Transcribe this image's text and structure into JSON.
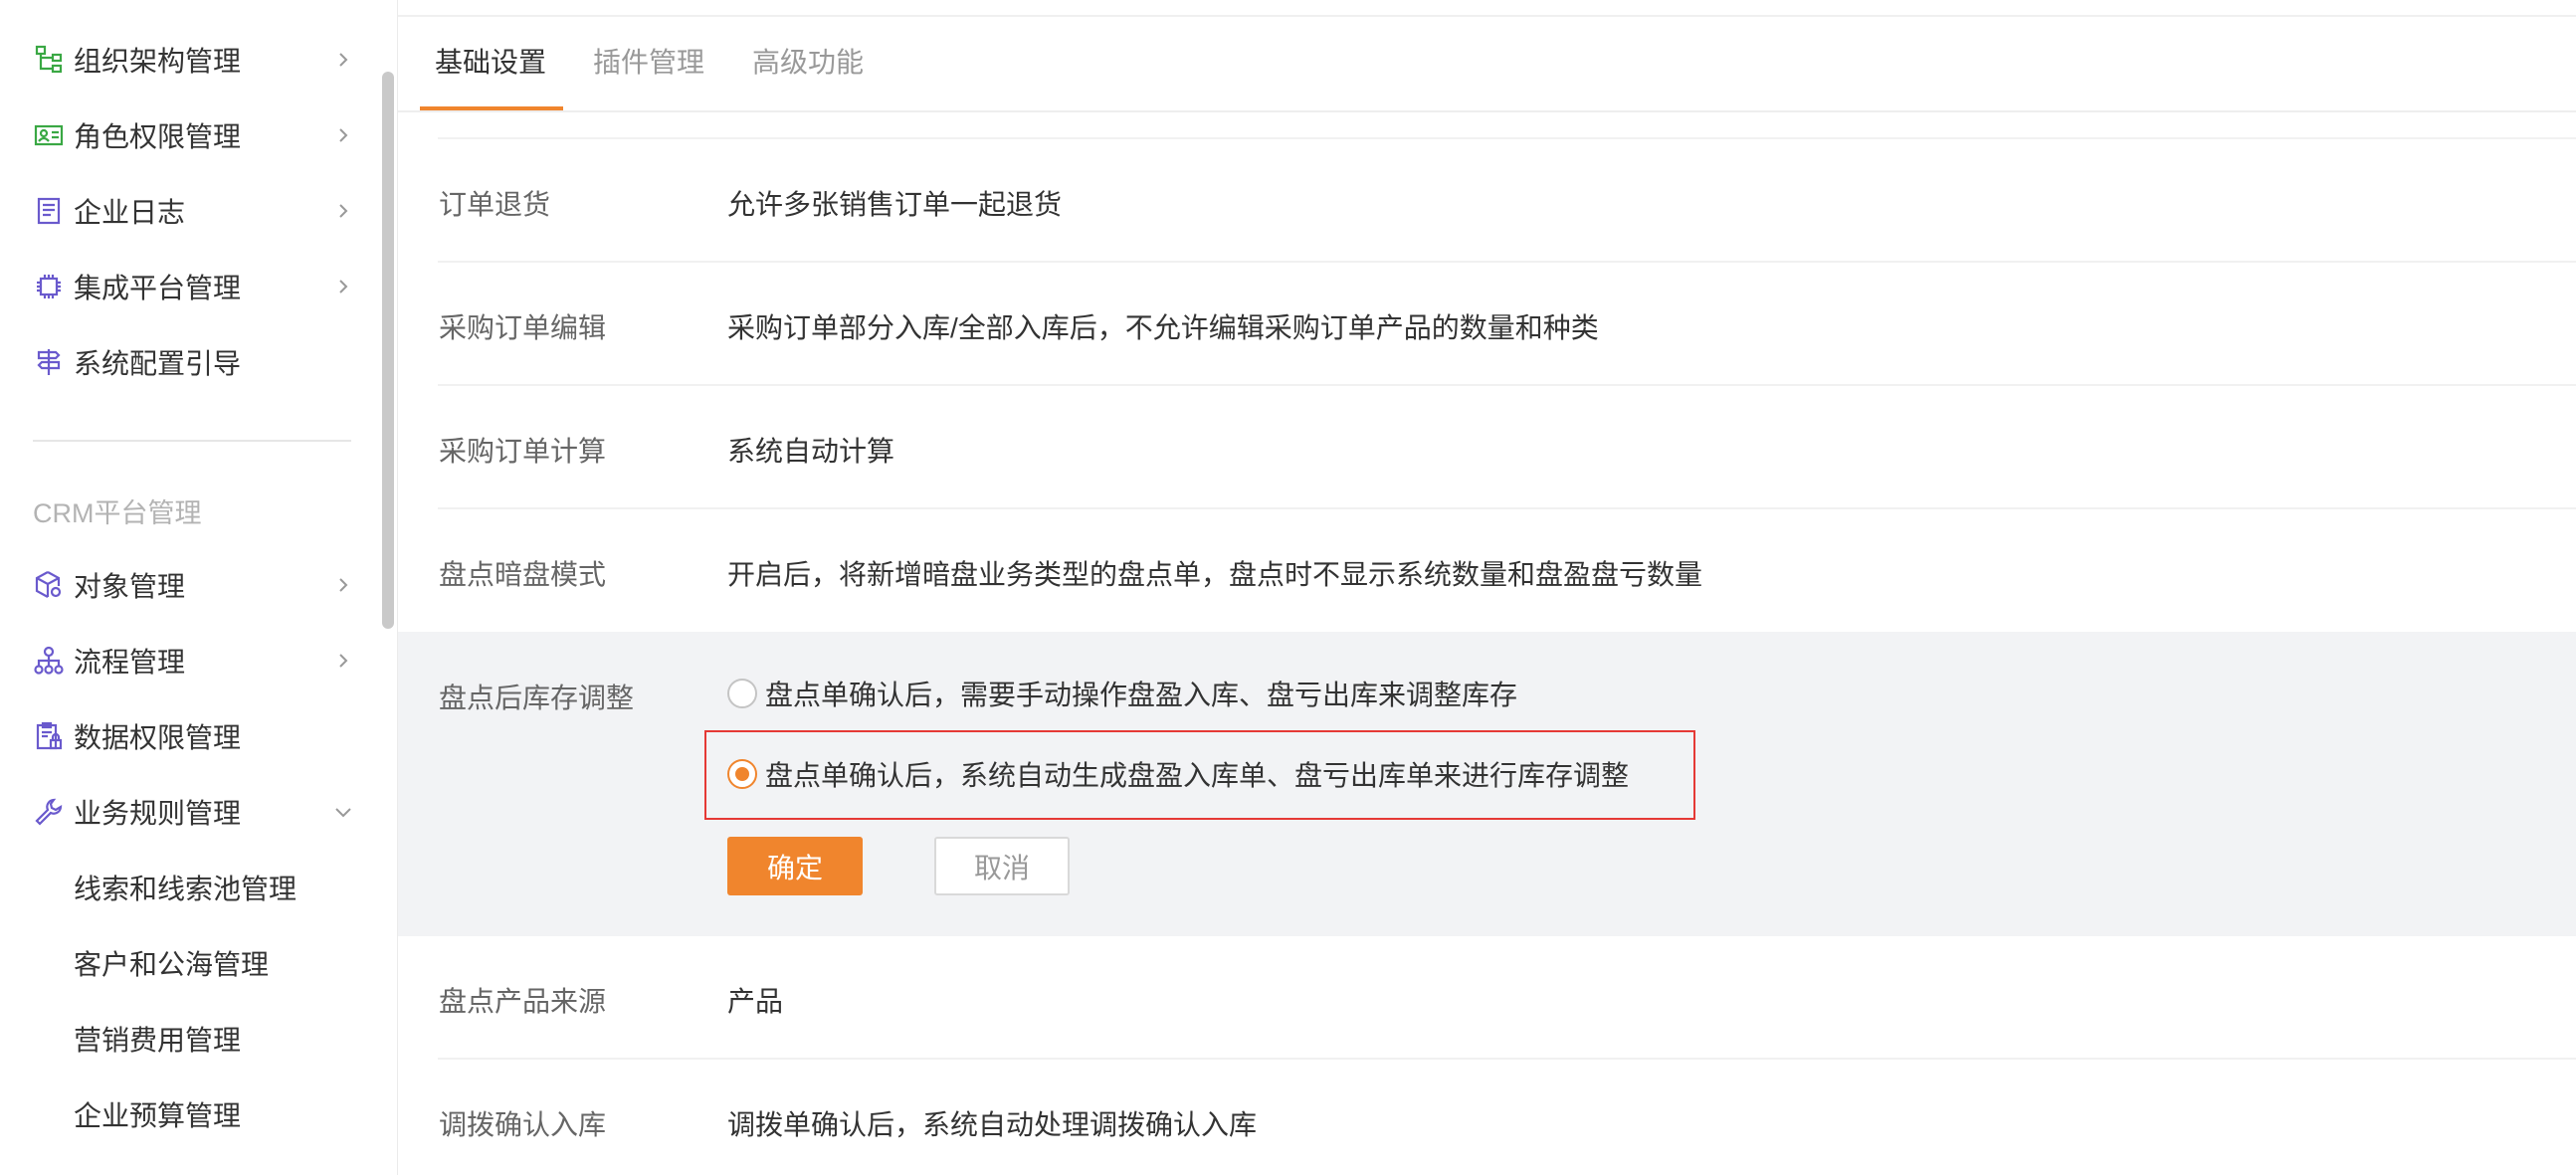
{
  "sidebar": {
    "items": [
      {
        "label": "组织架构管理",
        "icon": "org-structure-icon",
        "chevron": "right"
      },
      {
        "label": "角色权限管理",
        "icon": "role-card-icon",
        "chevron": "right"
      },
      {
        "label": "企业日志",
        "icon": "log-document-icon",
        "chevron": "right"
      },
      {
        "label": "集成平台管理",
        "icon": "chip-icon",
        "chevron": "right"
      },
      {
        "label": "系统配置引导",
        "icon": "signpost-icon",
        "chevron": ""
      }
    ],
    "section_title": "CRM平台管理",
    "crm_items": [
      {
        "label": "对象管理",
        "icon": "cube-gear-icon",
        "chevron": "right"
      },
      {
        "label": "流程管理",
        "icon": "flow-tree-icon",
        "chevron": "right"
      },
      {
        "label": "数据权限管理",
        "icon": "clipboard-lock-icon",
        "chevron": ""
      },
      {
        "label": "业务规则管理",
        "icon": "wrench-icon",
        "chevron": "down"
      }
    ],
    "sub_items": [
      {
        "label": "线索和线索池管理"
      },
      {
        "label": "客户和公海管理"
      },
      {
        "label": "营销费用管理"
      },
      {
        "label": "企业预算管理"
      }
    ]
  },
  "tabs": [
    {
      "label": "基础设置",
      "active": true
    },
    {
      "label": "插件管理",
      "active": false
    },
    {
      "label": "高级功能",
      "active": false
    }
  ],
  "settings": [
    {
      "label": "订单退货",
      "value": "允许多张销售订单一起退货"
    },
    {
      "label": "采购订单编辑",
      "value": "采购订单部分入库/全部入库后，不允许编辑采购订单产品的数量和种类"
    },
    {
      "label": "采购订单计算",
      "value": "系统自动计算"
    },
    {
      "label": "盘点暗盘模式",
      "value": "开启后，将新增暗盘业务类型的盘点单，盘点时不显示系统数量和盘盈盘亏数量"
    }
  ],
  "editing": {
    "label": "盘点后库存调整",
    "options": [
      {
        "text": "盘点单确认后，需要手动操作盘盈入库、盘亏出库来调整库存",
        "checked": false
      },
      {
        "text": "盘点单确认后，系统自动生成盘盈入库单、盘亏出库单来进行库存调整",
        "checked": true
      }
    ],
    "confirm_label": "确定",
    "cancel_label": "取消"
  },
  "settings_after": [
    {
      "label": "盘点产品来源",
      "value": "产品"
    },
    {
      "label": "调拨确认入库",
      "value": "调拨单确认后，系统自动处理调拨确认入库"
    }
  ],
  "colors": {
    "accent": "#f0852d",
    "highlight_border": "#e53935",
    "panel_bg": "#f2f3f5"
  }
}
